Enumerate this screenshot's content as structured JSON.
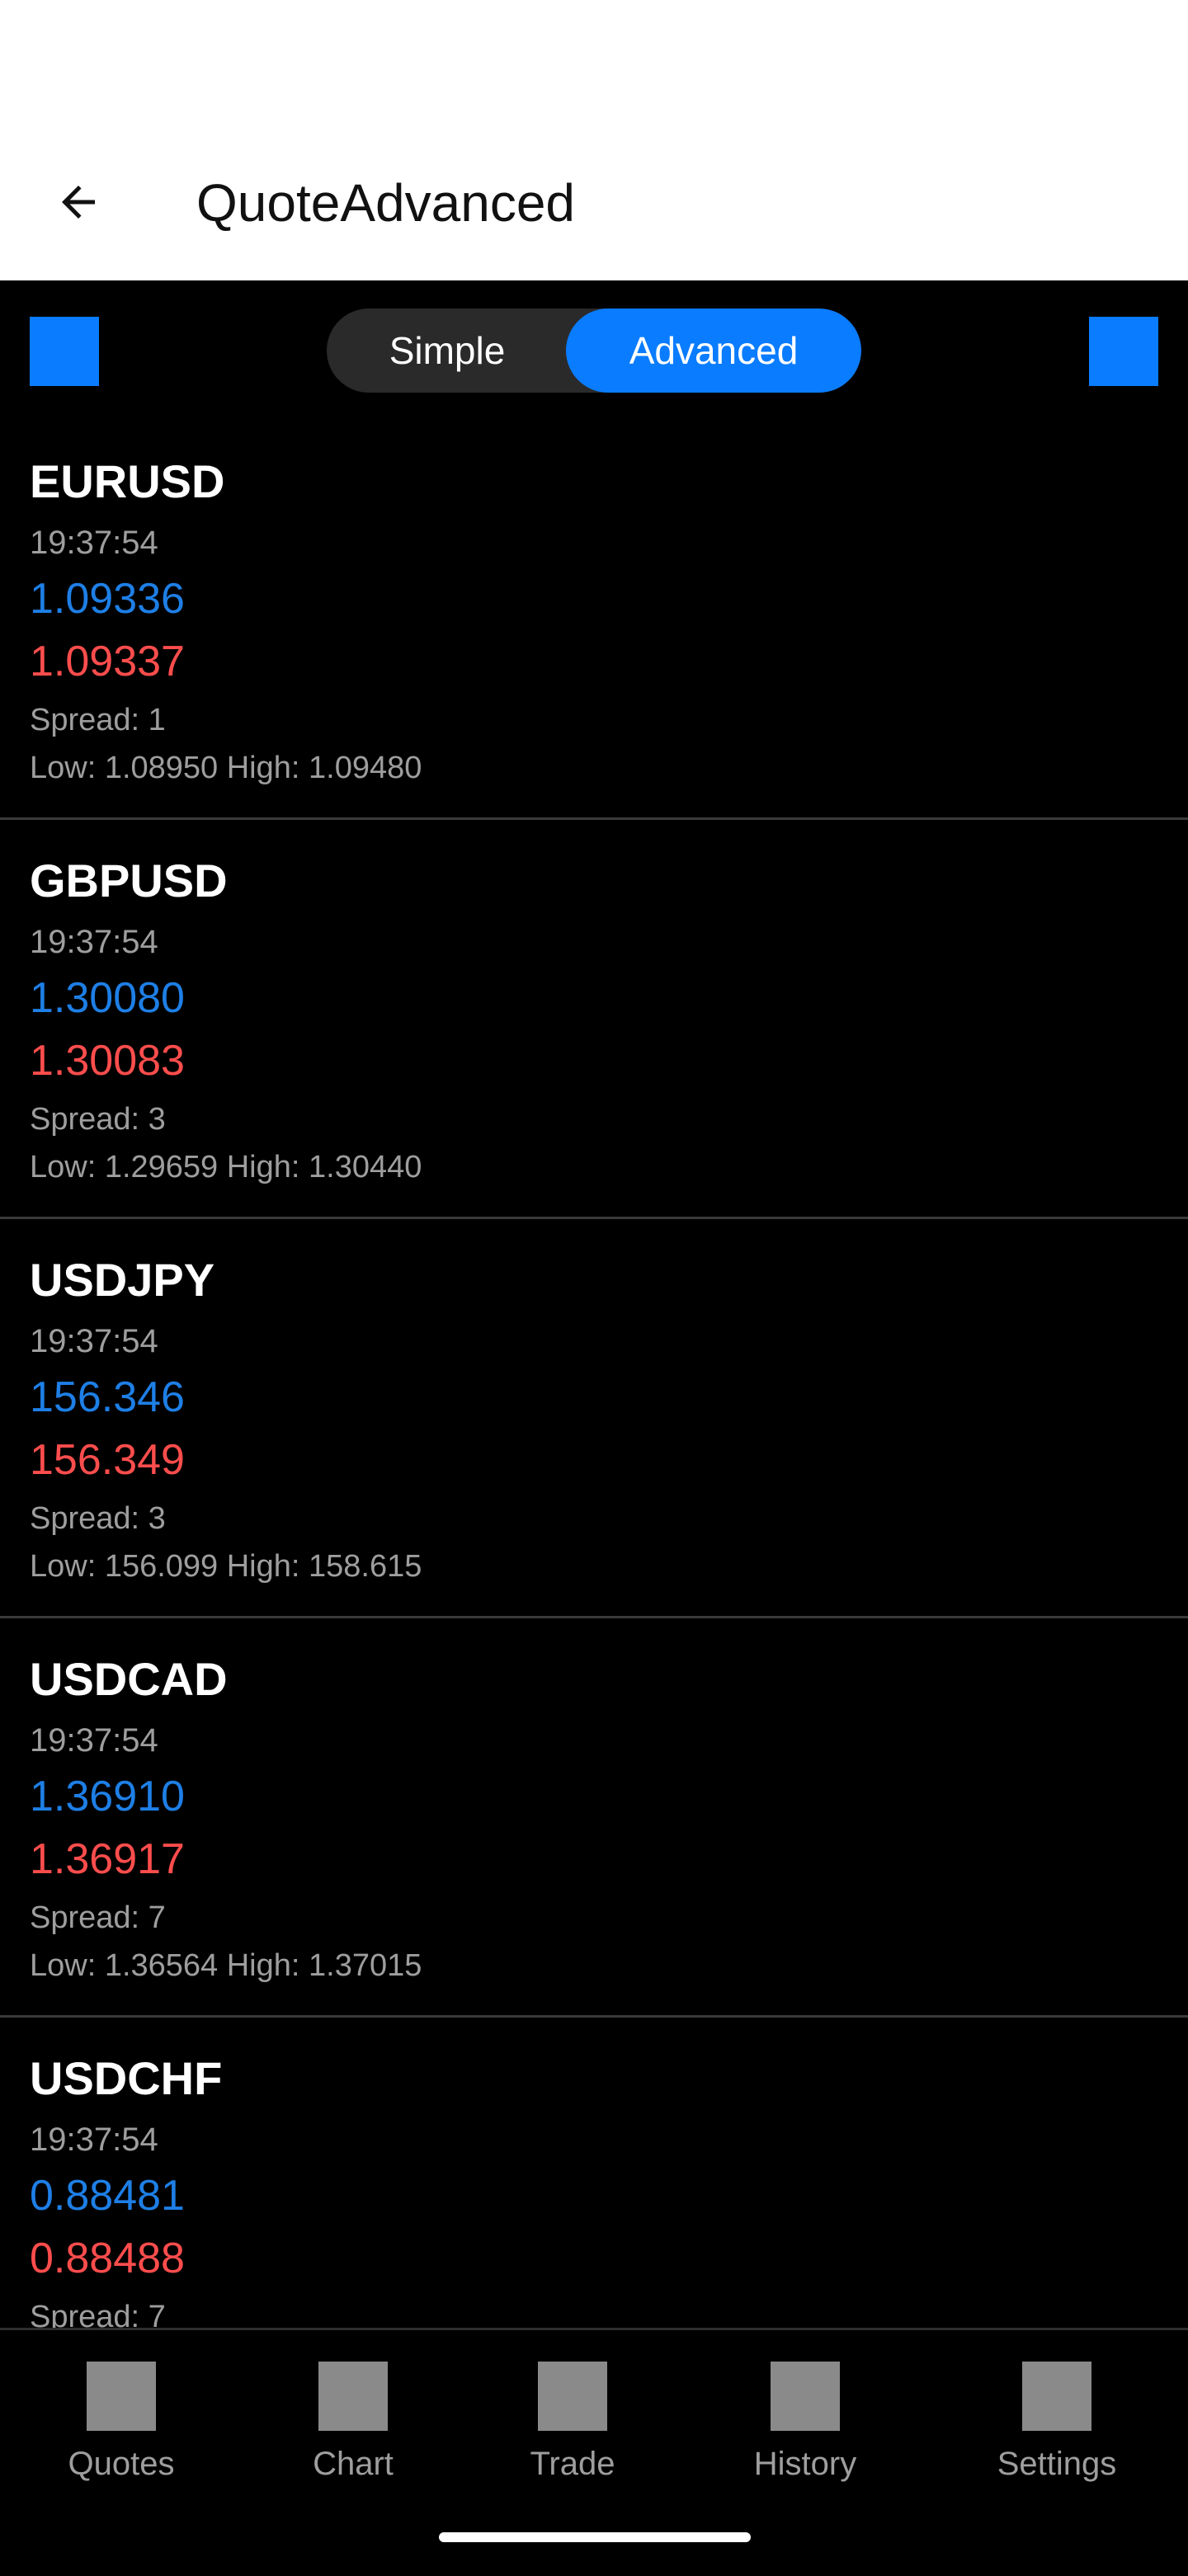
{
  "colors": {
    "accent": "#0a7cff",
    "bid": "#1e7fe6",
    "ask": "#ff4d4d",
    "appbar_bg": "#ffffff",
    "page_bg": "#000000",
    "nav_icon": "#8a8a8a"
  },
  "appbar": {
    "title": "QuoteAdvanced",
    "back_icon": "arrow-left-icon"
  },
  "toolbar": {
    "left_icon": "blue-square-icon",
    "right_icon": "blue-square-icon",
    "segments": [
      "Simple",
      "Advanced"
    ],
    "selected": "Advanced"
  },
  "quotes": [
    {
      "symbol": "EURUSD",
      "time": "19:37:54",
      "bid": "1.09336",
      "ask": "1.09337",
      "spread": "Spread: 1",
      "range": "Low: 1.08950 High: 1.09480"
    },
    {
      "symbol": "GBPUSD",
      "time": "19:37:54",
      "bid": "1.30080",
      "ask": "1.30083",
      "spread": "Spread: 3",
      "range": "Low: 1.29659 High: 1.30440"
    },
    {
      "symbol": "USDJPY",
      "time": "19:37:54",
      "bid": "156.346",
      "ask": "156.349",
      "spread": "Spread: 3",
      "range": "Low: 156.099 High: 158.615"
    },
    {
      "symbol": "USDCAD",
      "time": "19:37:54",
      "bid": "1.36910",
      "ask": "1.36917",
      "spread": "Spread: 7",
      "range": "Low: 1.36564 High: 1.37015"
    },
    {
      "symbol": "USDCHF",
      "time": "19:37:54",
      "bid": "0.88481",
      "ask": "0.88488",
      "spread": "Spread: 7",
      "range": ""
    }
  ],
  "nav": [
    {
      "label": "Quotes",
      "icon": "quotes-icon"
    },
    {
      "label": "Chart",
      "icon": "chart-icon"
    },
    {
      "label": "Trade",
      "icon": "trade-icon"
    },
    {
      "label": "History",
      "icon": "history-icon"
    },
    {
      "label": "Settings",
      "icon": "settings-icon"
    }
  ]
}
